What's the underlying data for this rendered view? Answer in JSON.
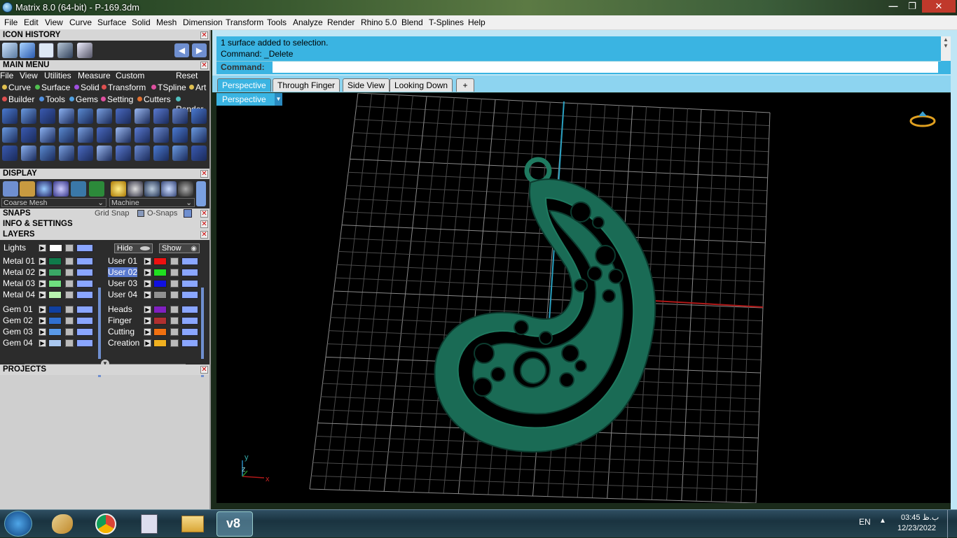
{
  "window": {
    "title": "Matrix 8.0 (64-bit) - P-169.3dm",
    "buttons": [
      "—",
      "❐",
      "✕"
    ]
  },
  "menu": [
    "File",
    "Edit",
    "View",
    "Curve",
    "Surface",
    "Solid",
    "Mesh",
    "Dimension",
    "Transform",
    "Tools",
    "Analyze",
    "Render",
    "Rhino 5.0",
    "Blend",
    "T-Splines",
    "Help"
  ],
  "panels": {
    "icon_history": "ICON HISTORY",
    "main_menu": "MAIN MENU",
    "display": "DISPLAY",
    "snaps": "SNAPS",
    "info_settings": "INFO & SETTINGS",
    "layers": "LAYERS",
    "projects": "PROJECTS"
  },
  "main_menu_items": [
    "File",
    "View",
    "Utilities",
    "Measure",
    "Custom"
  ],
  "main_menu_reset": "Reset",
  "categories_row1": [
    {
      "label": "Curve",
      "color": "#e0c050"
    },
    {
      "label": "Surface",
      "color": "#50c050"
    },
    {
      "label": "Solid",
      "color": "#a050e0"
    },
    {
      "label": "Transform",
      "color": "#e05050"
    },
    {
      "label": "TSpline",
      "color": "#e050a0"
    },
    {
      "label": "Art",
      "color": "#e0c050"
    }
  ],
  "categories_row2": [
    {
      "label": "Builder",
      "color": "#e05050"
    },
    {
      "label": "Tools",
      "color": "#5090e0"
    },
    {
      "label": "Gems",
      "color": "#50a0e0"
    },
    {
      "label": "Setting",
      "color": "#e050a0"
    },
    {
      "label": "Cutters",
      "color": "#e07030"
    },
    {
      "label": "Render",
      "color": "#50c0c0"
    }
  ],
  "display": {
    "mesh_select": "Coarse Mesh",
    "material_select": "Machine"
  },
  "snaps": {
    "grid_snap": "Grid Snap",
    "osnaps": "O-Snaps"
  },
  "layers": {
    "lights": "Lights",
    "hide": "Hide",
    "show": "Show",
    "left": [
      {
        "name": "Metal 01",
        "color": "#0f7a4a"
      },
      {
        "name": "Metal 02",
        "color": "#3aa866"
      },
      {
        "name": "Metal 03",
        "color": "#6fe07f"
      },
      {
        "name": "Metal 04",
        "color": "#b8f3b0"
      },
      {
        "name": "Gem 01",
        "color": "#1040a0"
      },
      {
        "name": "Gem 02",
        "color": "#3070d0"
      },
      {
        "name": "Gem 03",
        "color": "#5a9ae8"
      },
      {
        "name": "Gem 04",
        "color": "#aac8f0"
      }
    ],
    "right": [
      {
        "name": "User 01",
        "color": "#ee1010"
      },
      {
        "name": "User 02",
        "color": "#20e020"
      },
      {
        "name": "User 03",
        "color": "#1010e0"
      },
      {
        "name": "User 04",
        "color": "#909090"
      },
      {
        "name": "Heads",
        "color": "#8020c0"
      },
      {
        "name": "Finger",
        "color": "#b03030"
      },
      {
        "name": "Cutting",
        "color": "#f07010"
      },
      {
        "name": "Creation",
        "color": "#f0b020"
      }
    ]
  },
  "command": {
    "line1": "1 surface added to selection.",
    "line2": "Command: _Delete",
    "prompt": "Command:"
  },
  "viewport_tabs": [
    "Perspective",
    "Through Finger",
    "Side View",
    "Looking Down"
  ],
  "viewport_label": "Perspective",
  "axis": {
    "x": "x",
    "y": "y",
    "z": "z"
  },
  "taskbar": {
    "lang": "EN",
    "time": "03:45 ب.ظ",
    "date": "12/23/2022",
    "active_app": "v8"
  }
}
